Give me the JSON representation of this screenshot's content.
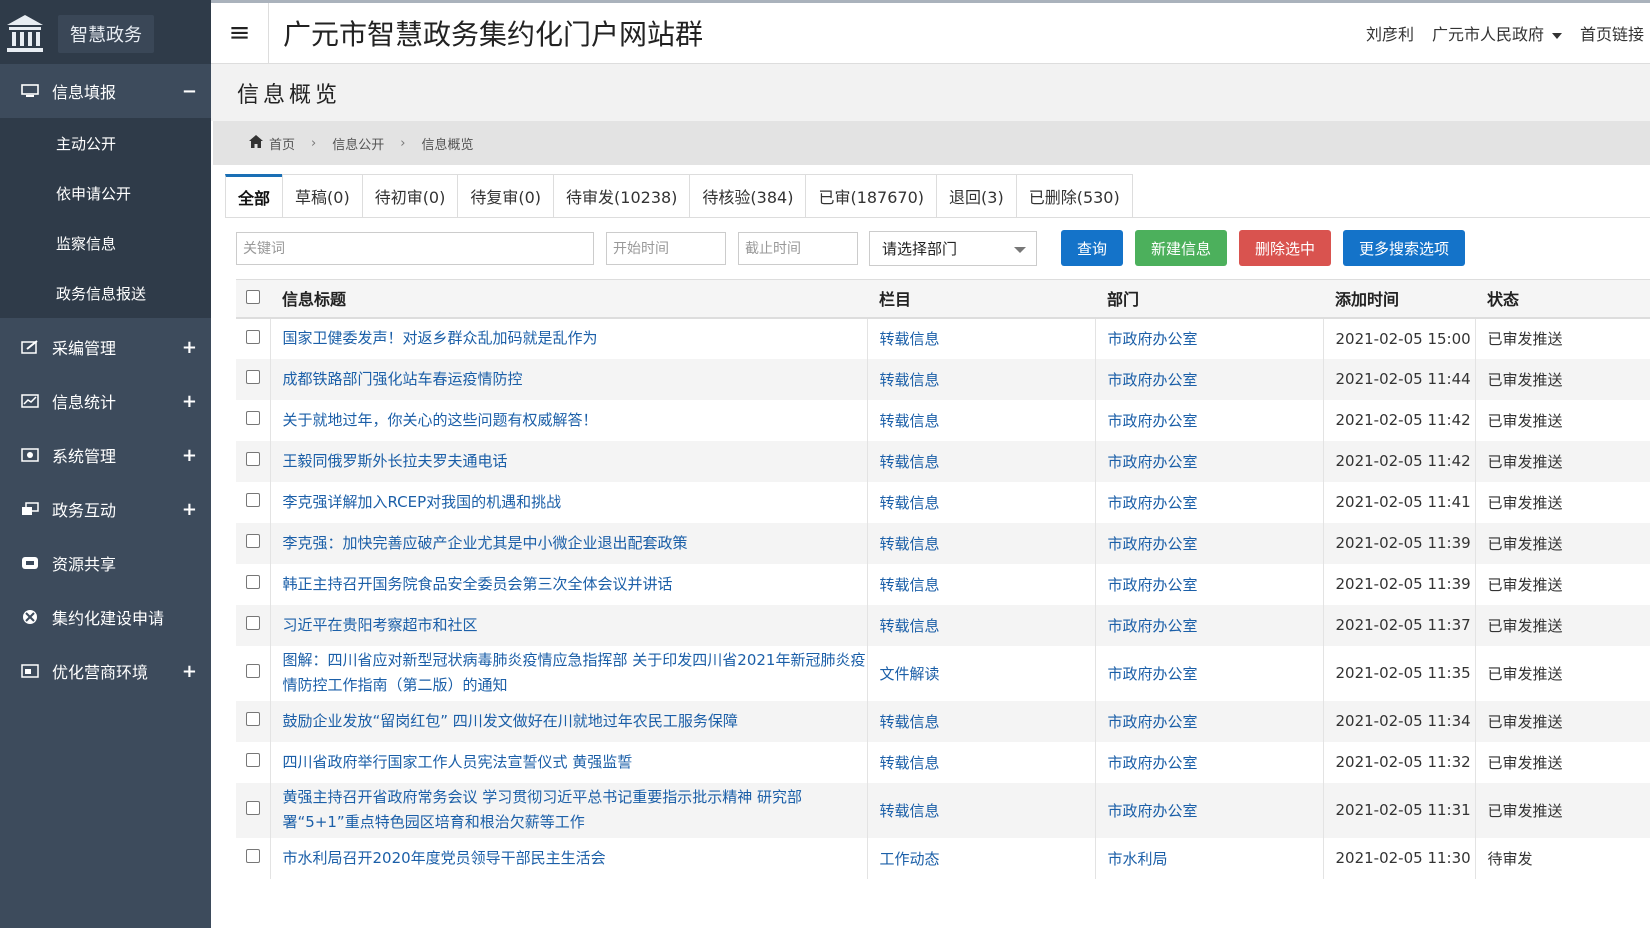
{
  "brand": {
    "name": "智慧政务"
  },
  "sidebar": {
    "items": [
      {
        "label": "信息填报",
        "toggle": "−",
        "icon": "monitor-icon"
      },
      {
        "label": "采编管理",
        "toggle": "+",
        "icon": "edit-icon"
      },
      {
        "label": "信息统计",
        "toggle": "+",
        "icon": "chart-icon"
      },
      {
        "label": "系统管理",
        "toggle": "+",
        "icon": "settings-icon"
      },
      {
        "label": "政务互动",
        "toggle": "+",
        "icon": "chat-icon"
      },
      {
        "label": "资源共享",
        "toggle": "",
        "icon": "share-icon"
      },
      {
        "label": "集约化建设申请",
        "toggle": "",
        "icon": "apply-icon"
      },
      {
        "label": "优化营商环境",
        "toggle": "+",
        "icon": "business-icon"
      }
    ],
    "submenu": [
      "主动公开",
      "依申请公开",
      "监察信息",
      "政务信息报送"
    ]
  },
  "header": {
    "title": "广元市智慧政务集约化门户网站群",
    "user": "刘彦利",
    "org": "广元市人民政府",
    "links": "首页链接"
  },
  "page": {
    "title": "信息概览",
    "breadcrumb": [
      "首页",
      "信息公开",
      "信息概览"
    ]
  },
  "tabs": [
    "全部",
    "草稿(0)",
    "待初审(0)",
    "待复审(0)",
    "待审发(10238)",
    "待核验(384)",
    "已审(187670)",
    "退回(3)",
    "已删除(530)"
  ],
  "filters": {
    "keyword_placeholder": "关键词",
    "start_placeholder": "开始时间",
    "end_placeholder": "截止时间",
    "dept_select": "请选择部门",
    "btn_query": "查询",
    "btn_new": "新建信息",
    "btn_delete": "删除选中",
    "btn_more": "更多搜索选项"
  },
  "table": {
    "headers": [
      "信息标题",
      "栏目",
      "部门",
      "添加时间",
      "状态"
    ],
    "rows": [
      {
        "title": "国家卫健委发声！对返乡群众乱加码就是乱作为",
        "column": "转载信息",
        "dept": "市政府办公室",
        "time": "2021-02-05 15:00",
        "status": "已审发推送"
      },
      {
        "title": "成都铁路部门强化站车春运疫情防控",
        "column": "转载信息",
        "dept": "市政府办公室",
        "time": "2021-02-05 11:44",
        "status": "已审发推送"
      },
      {
        "title": "关于就地过年，你关心的这些问题有权威解答！",
        "column": "转载信息",
        "dept": "市政府办公室",
        "time": "2021-02-05 11:42",
        "status": "已审发推送"
      },
      {
        "title": "王毅同俄罗斯外长拉夫罗夫通电话",
        "column": "转载信息",
        "dept": "市政府办公室",
        "time": "2021-02-05 11:42",
        "status": "已审发推送"
      },
      {
        "title": "李克强详解加入RCEP对我国的机遇和挑战",
        "column": "转载信息",
        "dept": "市政府办公室",
        "time": "2021-02-05 11:41",
        "status": "已审发推送"
      },
      {
        "title": "李克强：加快完善应破产企业尤其是中小微企业退出配套政策",
        "column": "转载信息",
        "dept": "市政府办公室",
        "time": "2021-02-05 11:39",
        "status": "已审发推送"
      },
      {
        "title": "韩正主持召开国务院食品安全委员会第三次全体会议并讲话",
        "column": "转载信息",
        "dept": "市政府办公室",
        "time": "2021-02-05 11:39",
        "status": "已审发推送"
      },
      {
        "title": "习近平在贵阳考察超市和社区",
        "column": "转载信息",
        "dept": "市政府办公室",
        "time": "2021-02-05 11:37",
        "status": "已审发推送"
      },
      {
        "title": "图解：四川省应对新型冠状病毒肺炎疫情应急指挥部 关于印发四川省2021年新冠肺炎疫情防控工作指南（第二版）的通知",
        "column": "文件解读",
        "dept": "市政府办公室",
        "time": "2021-02-05 11:35",
        "status": "已审发推送"
      },
      {
        "title": "鼓励企业发放“留岗红包” 四川发文做好在川就地过年农民工服务保障",
        "column": "转载信息",
        "dept": "市政府办公室",
        "time": "2021-02-05 11:34",
        "status": "已审发推送"
      },
      {
        "title": "四川省政府举行国家工作人员宪法宣誓仪式 黄强监誓",
        "column": "转载信息",
        "dept": "市政府办公室",
        "time": "2021-02-05 11:32",
        "status": "已审发推送"
      },
      {
        "title": "黄强主持召开省政府常务会议 学习贯彻习近平总书记重要指示批示精神 研究部署“5+1”重点特色园区培育和根治欠薪等工作",
        "column": "转载信息",
        "dept": "市政府办公室",
        "time": "2021-02-05 11:31",
        "status": "已审发推送"
      },
      {
        "title": "市水利局召开2020年度党员领导干部民主生活会",
        "column": "工作动态",
        "dept": "市水利局",
        "time": "2021-02-05 11:30",
        "status": "待审发"
      }
    ]
  },
  "colors": {
    "sidebar_bg": "#3d4b5c",
    "link": "#1b5fa8",
    "primary": "#1473c9",
    "success": "#4cb05c",
    "danger": "#d9534f"
  }
}
